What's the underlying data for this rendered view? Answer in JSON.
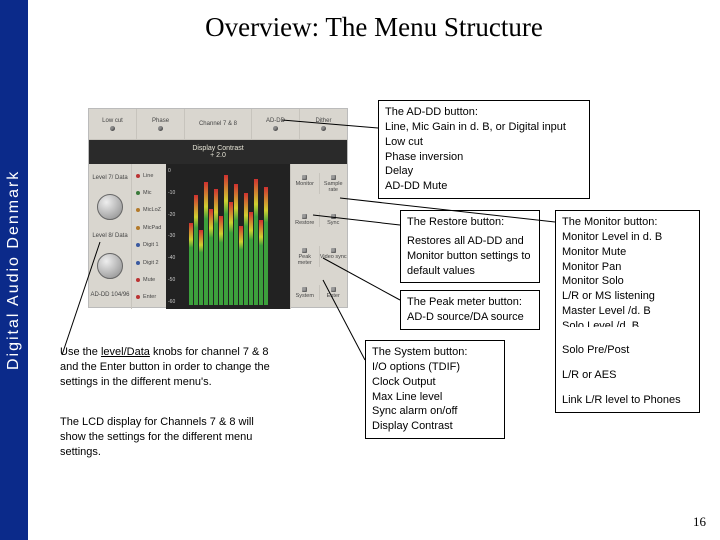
{
  "brand": "Digital Audio Denmark",
  "title": "Overview: The Menu Structure",
  "page_number": "16",
  "panel": {
    "top_labels": [
      "Low cut",
      "Phase",
      "Channel 7 & 8",
      "AD-DD",
      "Dither"
    ],
    "lcd_line1": "Display Contrast",
    "lcd_line2": "+ 2.0",
    "knob_labels": [
      "Level 7/ Data",
      "Level 8/ Data"
    ],
    "knob_bottom": "AD-DD 104/96",
    "led_names": [
      "Line",
      "Mic",
      "MicLoZ",
      "MicPad",
      "Digit 1",
      "Digit 2",
      "Mute",
      "Enter"
    ],
    "btn_rows": [
      [
        "Monitor",
        "Sample rate"
      ],
      [
        "Restore",
        "Sync"
      ],
      [
        "Peak meter",
        "Video sync"
      ],
      [
        "System",
        "Enter"
      ]
    ],
    "meter_scale": [
      "0",
      "-10",
      "-20",
      "-30",
      "-40",
      "-50",
      "-60"
    ],
    "meter_heights": [
      60,
      80,
      55,
      90,
      70,
      85,
      65,
      95,
      75,
      88,
      58,
      82,
      68,
      92,
      62,
      86
    ]
  },
  "boxes": {
    "addd": {
      "lead": "The AD-DD button:",
      "lines": [
        "Line, Mic Gain in d. B, or Digital input",
        "Low cut",
        "Phase inversion",
        "Delay",
        "AD-DD Mute"
      ]
    },
    "restore": {
      "lead": "The Restore button:",
      "lines": [
        "Restores all AD-DD and Monitor button settings to default values"
      ]
    },
    "peak": {
      "lead": "The Peak meter button:",
      "lines": [
        "AD-D source/DA source"
      ]
    },
    "system": {
      "lead": "The System button:",
      "lines": [
        "I/O options (TDIF)",
        "Clock Output",
        "Max Line level",
        "Sync alarm on/off",
        "Display Contrast"
      ]
    },
    "monitor": {
      "lead": "The Monitor button:",
      "lines": [
        "Monitor Level in d. B",
        "Monitor Mute",
        "Monitor Pan",
        "Monitor Solo",
        "L/R or MS listening",
        "Master Level /d. B",
        "Solo Level /d. B"
      ],
      "extra": [
        "Solo Pre/Post",
        "L/R or AES",
        "Link L/R level to Phones"
      ]
    }
  },
  "notes": {
    "n1": "Use the level/Data knobs for channel 7 & 8 and the Enter button in order to change the settings in the different menu's.",
    "n1_emph": "level/Data",
    "n2": "The LCD display for Channels 7 & 8 will show the settings for the different menu settings."
  }
}
